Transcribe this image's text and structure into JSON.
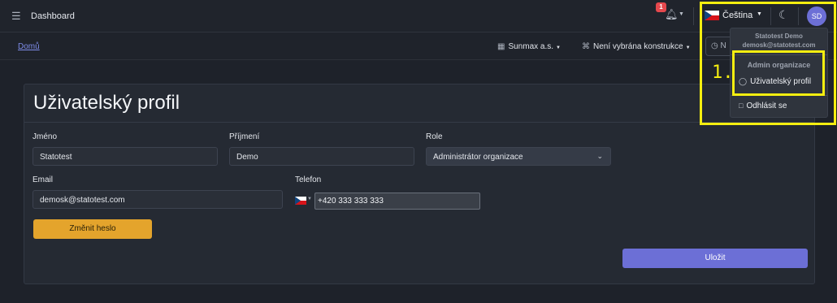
{
  "topbar": {
    "title": "Dashboard",
    "notification_count": "1",
    "language": "Čeština",
    "avatar_initials": "SD"
  },
  "subbar": {
    "breadcrumb": "Domů",
    "company": "Sunmax a.s.",
    "construction": "Není vybrána konstrukce",
    "search_partial": "N"
  },
  "card": {
    "title": "Uživatelský profil",
    "fields": {
      "first_name_label": "Jméno",
      "first_name_value": "Statotest",
      "last_name_label": "Příjmení",
      "last_name_value": "Demo",
      "role_label": "Role",
      "role_value": "Administrátor organizace",
      "email_label": "Email",
      "email_value": "demosk@statotest.com",
      "phone_label": "Telefon",
      "phone_value": "+420 333 333 333"
    },
    "change_password_label": "Změnit heslo",
    "save_label": "Uložit"
  },
  "user_menu": {
    "user_name": "Statotest Demo",
    "user_email": "demosk@statotest.com",
    "section_header": "Admin organizace",
    "profile_label": "Uživatelský profil",
    "logout_label": "Odhlásit se"
  },
  "annotation": {
    "step_label": "1."
  },
  "colors": {
    "accent": "#6c6fd6",
    "warning_button": "#e4a42c",
    "highlight": "#f5ee10",
    "badge": "#e5484d"
  },
  "icons": [
    "menu-icon",
    "bell-icon",
    "czech-flag-icon",
    "moon-icon",
    "company-icon",
    "construction-icon",
    "clock-icon",
    "chevron-down-icon",
    "user-icon",
    "lock-icon"
  ]
}
